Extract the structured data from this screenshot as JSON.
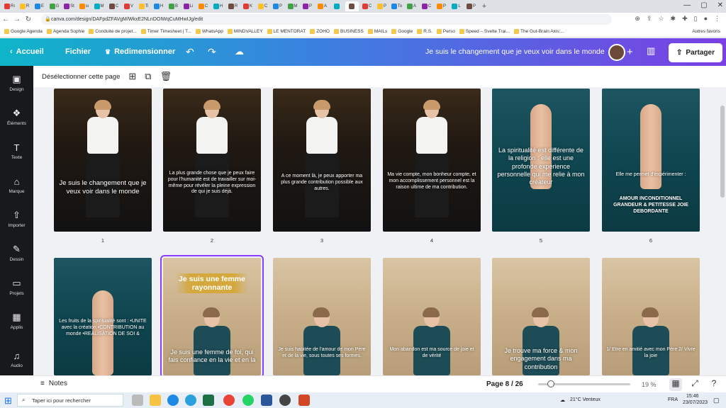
{
  "browser": {
    "tabs": [
      "Rı",
      "R",
      "E",
      "G",
      "St",
      "sı",
      "M",
      "C",
      "V",
      "Ti",
      "H",
      "B",
      "Li",
      "C",
      "H",
      "R",
      "K",
      "C",
      "P",
      "M",
      "P",
      "A",
      "",
      "",
      "C",
      "P",
      "To",
      "A",
      "C",
      "P",
      "L",
      "P"
    ],
    "active_tab_index": 23,
    "url": "canva.com/design/DAFpdZFAVgM/WkxE2NLnDOIWqCuMHwIJg/edit",
    "bookmarks": [
      "Google Agenda",
      "Agenda Sophie",
      "Conduite de projet...",
      "Timer Timesheet | T...",
      "WhatsApp",
      "MINDVALLEY",
      "LE MENTORAT",
      "ZOHO",
      "BUSINESS",
      "MAILs",
      "Google",
      "R.S.",
      "Perso",
      "Speed – Svelte Trai...",
      "The Gut-Brain Axis:..."
    ],
    "bookmarks_more": "Autres favoris"
  },
  "topbar": {
    "back_label": "Accueil",
    "file_label": "Fichier",
    "resize_label": "Redimensionner",
    "design_title": "Je suis le changement que je veux voir dans le monde",
    "share_label": "Partager"
  },
  "sidebar": {
    "items": [
      {
        "label": "Design",
        "icon": "design-icon",
        "glyph": "▣"
      },
      {
        "label": "Éléments",
        "icon": "elements-icon",
        "glyph": "❖"
      },
      {
        "label": "Texte",
        "icon": "text-icon",
        "glyph": "T"
      },
      {
        "label": "Marque",
        "icon": "brand-icon",
        "glyph": "⌂"
      },
      {
        "label": "Importer",
        "icon": "upload-icon",
        "glyph": "⇧"
      },
      {
        "label": "Dessin",
        "icon": "draw-icon",
        "glyph": "✎"
      },
      {
        "label": "Projets",
        "icon": "folder-icon",
        "glyph": "▭"
      },
      {
        "label": "Applis",
        "icon": "apps-icon",
        "glyph": "▦"
      },
      {
        "label": "Audio",
        "icon": "audio-icon",
        "glyph": "♫"
      }
    ]
  },
  "toolbar": {
    "deselect_label": "Désélectionner cette page"
  },
  "pages": [
    {
      "num": "1",
      "bg": "dark",
      "text": "Je suis le changement que je veux voir dans le monde"
    },
    {
      "num": "2",
      "bg": "dark",
      "text": "La plus grande chose que je peux faire pour l'humanité est de travailler sur moi-même pour révéler la pleine expression de qui je suis déjà."
    },
    {
      "num": "3",
      "bg": "dark",
      "text": "A ce moment là, je peux apporter ma plus grande contribution possible aux autres."
    },
    {
      "num": "4",
      "bg": "dark",
      "text": "Ma vie compte, mon bonheur compte, et mon accomplissement personnel est la raison ultime de ma contribution."
    },
    {
      "num": "5",
      "bg": "teal",
      "text": "La spiritualité est différente de la religion : elle est une profonde expérience personnelle qui me relie à mon créateur"
    },
    {
      "num": "6",
      "bg": "teal",
      "text": "Elle me permet d'expérimenter :",
      "text2": "AMOUR INCONDITIONNEL GRANDEUR & PETITESSE JOIE DEBORDANTE"
    },
    {
      "num": "",
      "bg": "teal",
      "text": "Les fruits de la spiritualité sont : •UNITE avec la création •CONTRIBUTION au monde •REALISATION DE SOI &"
    },
    {
      "num": "",
      "bg": "sand",
      "banner": "Je suis une femme rayonnante",
      "text": "Je suis une femme de foi, qui fais confiance en la vie et en la"
    },
    {
      "num": "",
      "bg": "sand",
      "text": "Je suis habitée de l'amour de mon Père et de la vie, sous toutes ses formes."
    },
    {
      "num": "",
      "bg": "sand",
      "text": "Mon abandon est ma source de joie et de vérité"
    },
    {
      "num": "",
      "bg": "sand",
      "text": "Je trouve ma force & mon engagement dans ma contribution"
    },
    {
      "num": "",
      "bg": "sand",
      "text": "1/ Etre en amitié avec mon Père 2/ Vivre la joie"
    }
  ],
  "footer": {
    "notes_label": "Notes",
    "page_indicator": "Page 8 / 26",
    "zoom_label": "19 %",
    "zoom_level": 0.19
  },
  "taskbar": {
    "search_placeholder": "Taper ici pour rechercher",
    "weather": "21°C Venteux",
    "lang": "FRA",
    "time": "15:46",
    "date": "23/07/2023"
  }
}
